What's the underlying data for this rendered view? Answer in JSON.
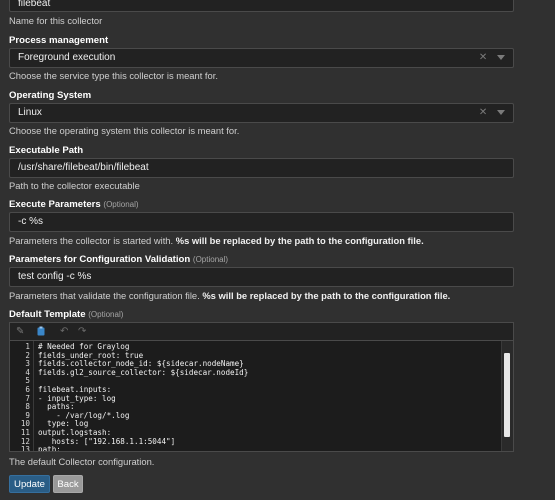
{
  "collector_name": {
    "value": "filebeat",
    "help": "Name for this collector"
  },
  "process_management": {
    "label": "Process management",
    "value": "Foreground execution",
    "help": "Choose the service type this collector is meant for."
  },
  "operating_system": {
    "label": "Operating System",
    "value": "Linux",
    "help": "Choose the operating system this collector is meant for."
  },
  "executable_path": {
    "label": "Executable Path",
    "value": "/usr/share/filebeat/bin/filebeat",
    "help": "Path to the collector executable"
  },
  "execute_parameters": {
    "label": "Execute Parameters",
    "optional": "(Optional)",
    "value": "-c  %s",
    "help_plain": "Parameters the collector is started with. ",
    "help_bold": "%s will be replaced by the path to the configuration file."
  },
  "validation_parameters": {
    "label": "Parameters for Configuration Validation",
    "optional": "(Optional)",
    "value": "test config -c %s",
    "help_plain": "Parameters that validate the configuration file. ",
    "help_bold": "%s will be replaced by the path to the configuration file."
  },
  "default_template": {
    "label": "Default Template",
    "optional": "(Optional)",
    "line_numbers": [
      "1",
      "2",
      "3",
      "4",
      "5",
      "6",
      "7",
      "8",
      "9",
      "10",
      "11",
      "12",
      "13"
    ],
    "lines": [
      "# Needed for Graylog",
      "fields_under_root: true",
      "fields.collector_node_id: ${sidecar.nodeName}",
      "fields.gl2_source_collector: ${sidecar.nodeId}",
      "",
      "filebeat.inputs:",
      "- input_type: log",
      "  paths:",
      "    - /var/log/*.log",
      "  type: log",
      "output.logstash:",
      "   hosts: [\"192.168.1.1:5044\"]",
      "path:"
    ],
    "help": "The default Collector configuration."
  },
  "toolbar": {
    "icons": [
      "pencil-icon",
      "copy-icon",
      "undo-icon",
      "redo-icon"
    ]
  },
  "buttons": {
    "update": "Update",
    "back": "Back"
  },
  "colors": {
    "primary": "#2a5d86",
    "background": "#303030",
    "secondary": "#9a9a9a"
  }
}
